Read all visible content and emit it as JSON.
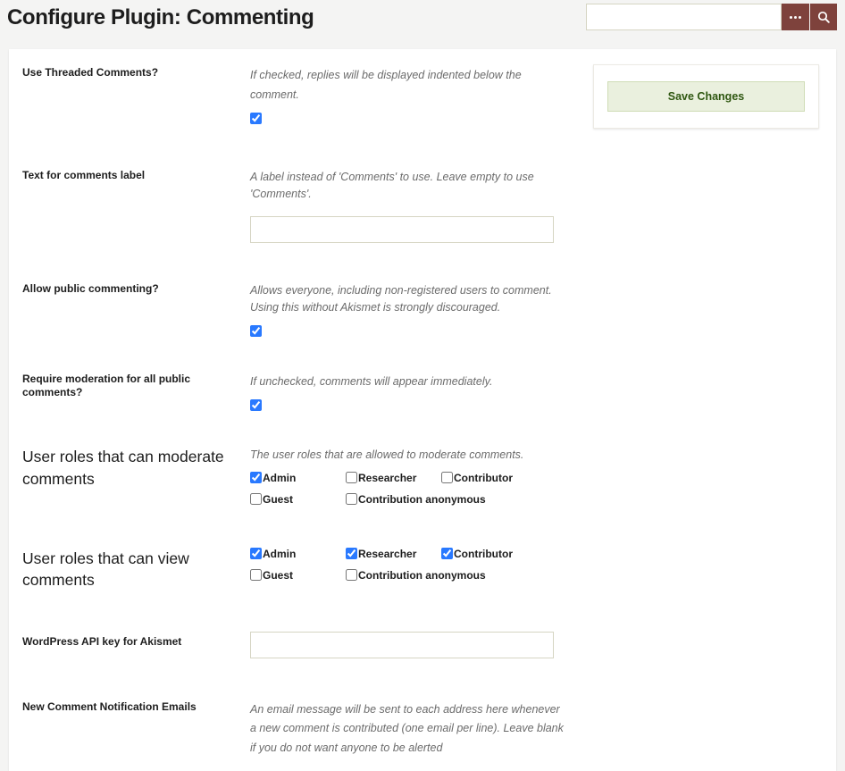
{
  "header": {
    "title": "Configure Plugin: Commenting",
    "search_value": "",
    "search_placeholder": "",
    "more_button_label": "",
    "search_button_label": ""
  },
  "sidebar": {
    "save_label": "Save Changes"
  },
  "fields": {
    "threaded": {
      "label": "Use Threaded Comments?",
      "help": "If checked, replies will be displayed indented below the comment.",
      "checked": true
    },
    "comments_label": {
      "label": "Text for comments label",
      "help": "A label instead of 'Comments' to use. Leave empty to use 'Comments'.",
      "value": ""
    },
    "public_commenting": {
      "label": "Allow public commenting?",
      "help": "Allows everyone, including non-registered users to comment. Using this without Akismet is strongly discouraged.",
      "checked": true
    },
    "require_moderation": {
      "label": "Require moderation for all public comments?",
      "help": "If unchecked, comments will appear immediately.",
      "checked": true
    },
    "moderate_roles": {
      "label": "User roles that can moderate comments",
      "help": "The user roles that are allowed to moderate comments.",
      "options": [
        {
          "label": "Admin",
          "checked": true
        },
        {
          "label": "Researcher",
          "checked": false
        },
        {
          "label": "Contributor",
          "checked": false
        },
        {
          "label": "Guest",
          "checked": false
        },
        {
          "label": "Contribution anonymous",
          "checked": false
        }
      ]
    },
    "view_roles": {
      "label": "User roles that can view comments",
      "help": "",
      "options": [
        {
          "label": "Admin",
          "checked": true
        },
        {
          "label": "Researcher",
          "checked": true
        },
        {
          "label": "Contributor",
          "checked": true
        },
        {
          "label": "Guest",
          "checked": false
        },
        {
          "label": "Contribution anonymous",
          "checked": false
        }
      ]
    },
    "akismet_key": {
      "label": "WordPress API key for Akismet",
      "value": ""
    },
    "notification_emails": {
      "label": "New Comment Notification Emails",
      "help": "An email message will be sent to each address here whenever a new comment is contributed (one email per line). Leave blank if you do not want anyone to be alerted"
    }
  },
  "colors": {
    "accent": "#7e423c",
    "save_bg": "#eaf0de",
    "save_text": "#2f5711",
    "checkbox": "#2979ff",
    "input_border": "#d6d5c3"
  }
}
